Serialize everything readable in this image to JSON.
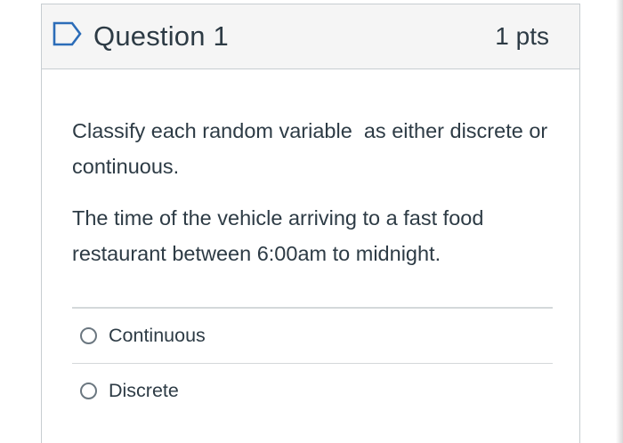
{
  "question": {
    "title": "Question 1",
    "points": "1 pts",
    "flag_icon": "bookmark-flag-icon",
    "paragraphs": [
      "Classify each random variable  as either discrete or continuous.",
      "The time of the vehicle arriving to a fast food restaurant between 6:00am to midnight."
    ],
    "answers": [
      {
        "label": "Continuous",
        "selected": false
      },
      {
        "label": "Discrete",
        "selected": false
      }
    ]
  },
  "colors": {
    "header_bg": "#f5f5f5",
    "border": "#c7cdd1",
    "text": "#2d3b45",
    "flag": "#2b6cb8"
  }
}
